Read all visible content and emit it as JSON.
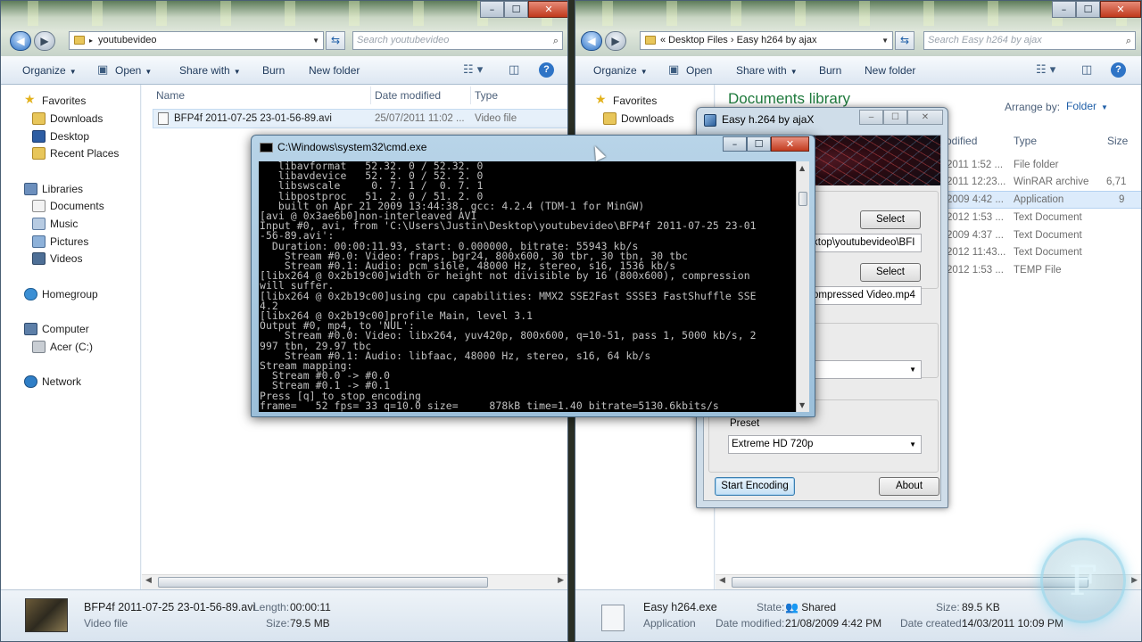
{
  "left_window": {
    "address": "youtubevideo",
    "search_placeholder": "Search youtubevideo",
    "toolbar": {
      "organize": "Organize",
      "open": "Open",
      "share_with": "Share with",
      "burn": "Burn",
      "new_folder": "New folder"
    },
    "nav": {
      "favorites": "Favorites",
      "downloads": "Downloads",
      "desktop": "Desktop",
      "recent_places": "Recent Places",
      "libraries": "Libraries",
      "documents": "Documents",
      "music": "Music",
      "pictures": "Pictures",
      "videos": "Videos",
      "homegroup": "Homegroup",
      "computer": "Computer",
      "drive": "Acer (C:)",
      "network": "Network"
    },
    "columns": {
      "name": "Name",
      "date_modified": "Date modified",
      "type": "Type"
    },
    "files": [
      {
        "name": "BFP4f 2011-07-25 23-01-56-89.avi",
        "date": "25/07/2011 11:02 ...",
        "type": "Video file"
      }
    ],
    "details": {
      "name": "BFP4f 2011-07-25 23-01-56-89.avi",
      "kind": "Video file",
      "length_label": "Length:",
      "length": "00:00:11",
      "size_label": "Size:",
      "size": "79.5 MB"
    }
  },
  "right_window": {
    "address": "«  Desktop Files  ›  Easy h264 by ajax",
    "search_placeholder": "Search Easy h264 by ajax",
    "toolbar": {
      "organize": "Organize",
      "open": "Open",
      "share_with": "Share with",
      "burn": "Burn",
      "new_folder": "New folder"
    },
    "nav": {
      "favorites": "Favorites",
      "downloads": "Downloads"
    },
    "library_title": "Documents library",
    "arrange_by_label": "Arrange by:",
    "arrange_by_value": "Folder",
    "columns": {
      "modified": "odified",
      "type": "Type",
      "size": "Size"
    },
    "rows": [
      {
        "date": "2011 1:52 ...",
        "type": "File folder",
        "size": ""
      },
      {
        "date": "2011 12:23...",
        "type": "WinRAR archive",
        "size": "6,71"
      },
      {
        "date": "2009 4:42 ...",
        "type": "Application",
        "size": "9"
      },
      {
        "date": "2012 1:53 ...",
        "type": "Text Document",
        "size": ""
      },
      {
        "date": "2009 4:37 ...",
        "type": "Text Document",
        "size": ""
      },
      {
        "date": "2012 11:43...",
        "type": "Text Document",
        "size": ""
      },
      {
        "date": "2012 1:53 ...",
        "type": "TEMP File",
        "size": ""
      }
    ],
    "details": {
      "name": "Easy h264.exe",
      "kind": "Application",
      "state_label": "State:",
      "state": "Shared",
      "modified_label": "Date modified:",
      "modified": "21/08/2009 4:42 PM",
      "size_label": "Size:",
      "size": "89.5 KB",
      "created_label": "Date created:",
      "created": "14/03/2011 10:09 PM"
    }
  },
  "dialog": {
    "title": "Easy h.264 by ajaX",
    "select1": "Select",
    "input_path": "ktop\\youtubevideo\\BFI",
    "select2": "Select",
    "output_path": "ompressed Video.mp4",
    "preset_label": "Preset",
    "preset_value": "Extreme HD 720p",
    "start_button": "Start Encoding",
    "about_button": "About"
  },
  "cmd": {
    "title": "C:\\Windows\\system32\\cmd.exe",
    "lines": [
      "   libavformat   52.32. 0 / 52.32. 0",
      "   libavdevice   52. 2. 0 / 52. 2. 0",
      "   libswscale     0. 7. 1 /  0. 7. 1",
      "   libpostproc   51. 2. 0 / 51. 2. 0",
      "   built on Apr 21 2009 13:44:38, gcc: 4.2.4 (TDM-1 for MinGW)",
      "[avi @ 0x3ae6b0]non-interleaved AVI",
      "Input #0, avi, from 'C:\\Users\\Justin\\Desktop\\youtubevideo\\BFP4f 2011-07-25 23-01",
      "-56-89.avi':",
      "  Duration: 00:00:11.93, start: 0.000000, bitrate: 55943 kb/s",
      "    Stream #0.0: Video: fraps, bgr24, 800x600, 30 tbr, 30 tbn, 30 tbc",
      "    Stream #0.1: Audio: pcm_s16le, 48000 Hz, stereo, s16, 1536 kb/s",
      "[libx264 @ 0x2b19c00]width or height not divisible by 16 (800x600), compression",
      "will suffer.",
      "[libx264 @ 0x2b19c00]using cpu capabilities: MMX2 SSE2Fast SSSE3 FastShuffle SSE",
      "4.2",
      "[libx264 @ 0x2b19c00]profile Main, level 3.1",
      "Output #0, mp4, to 'NUL':",
      "    Stream #0.0: Video: libx264, yuv420p, 800x600, q=10-51, pass 1, 5000 kb/s, 2",
      "997 tbn, 29.97 tbc",
      "    Stream #0.1: Audio: libfaac, 48000 Hz, stereo, s16, 64 kb/s",
      "Stream mapping:",
      "  Stream #0.0 -> #0.0",
      "  Stream #0.1 -> #0.1",
      "Press [q] to stop encoding",
      "frame=   52 fps= 33 q=10.0 size=     878kB time=1.40 bitrate=5130.6kbits/s"
    ]
  },
  "colors": {
    "library_title": "#1e7a3c",
    "link_blue": "#1f5fa8",
    "close_red": "#c0391c"
  }
}
